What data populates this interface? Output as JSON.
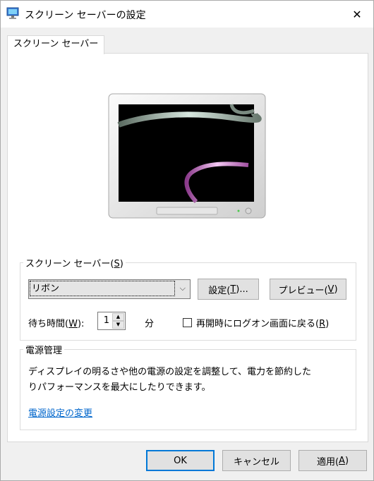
{
  "window": {
    "title": "スクリーン セーバーの設定",
    "close_glyph": "✕"
  },
  "tabs": [
    {
      "label": "スクリーン セーバー",
      "selected": true
    }
  ],
  "screensaver": {
    "group_label": "スクリーン セーバー(",
    "group_label_key": "S",
    "group_label_end": ")",
    "selected": "リボン",
    "settings_button": {
      "text": "設定(",
      "key": "T",
      "end": ")..."
    },
    "preview_button": {
      "text": "プレビュー(",
      "key": "V",
      "end": ")"
    },
    "wait_label": {
      "text": "待ち時間(",
      "key": "W",
      "end": "):"
    },
    "wait_value": "1",
    "wait_unit": "分",
    "resume_checkbox": {
      "text": "再開時にログオン画面に戻る(",
      "key": "R",
      "end": ")",
      "checked": false
    }
  },
  "power": {
    "group_label": "電源管理",
    "description_line1": "ディスプレイの明るさや他の電源の設定を調整して、電力を節約した",
    "description_line2": "りパフォーマンスを最大にしたりできます。",
    "link": "電源設定の変更"
  },
  "footer": {
    "ok": "OK",
    "cancel": "キャンセル",
    "apply": {
      "text": "適用(",
      "key": "A",
      "end": ")"
    }
  },
  "colors": {
    "accent": "#0078d7",
    "link": "#0066cc",
    "dialog_bg": "#f0f0f0"
  }
}
